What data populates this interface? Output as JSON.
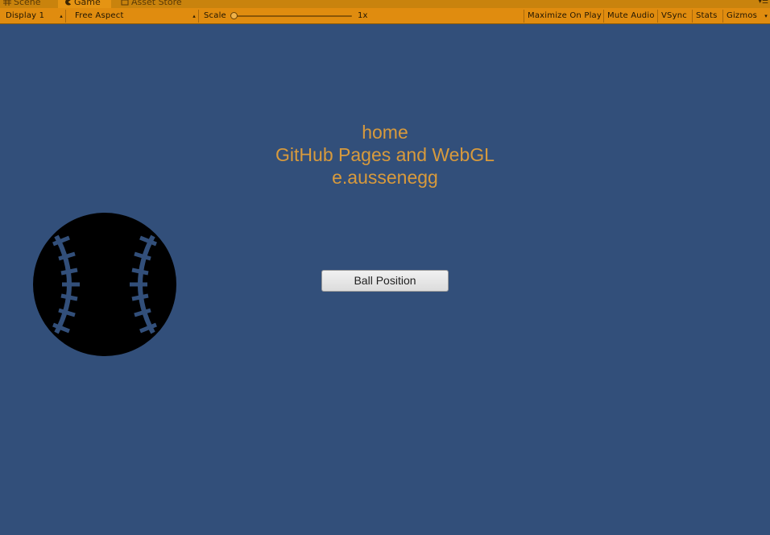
{
  "tabs": [
    {
      "label": "Scene",
      "icon": "grid-icon",
      "active": false
    },
    {
      "label": "Game",
      "icon": "pacman-icon",
      "active": true
    },
    {
      "label": "Asset Store",
      "icon": "store-icon",
      "active": false
    }
  ],
  "toolbar": {
    "display": "Display 1",
    "aspect": "Free Aspect",
    "scale_label": "Scale",
    "scale_value": "1x",
    "maximize_on_play": "Maximize On Play",
    "mute_audio": "Mute Audio",
    "vsync": "VSync",
    "stats": "Stats",
    "gizmos": "Gizmos"
  },
  "game": {
    "title_lines": [
      "home",
      "GitHub Pages and WebGL",
      "e.aussenegg"
    ],
    "button_label": "Ball Position",
    "background_color": "#324f7a",
    "text_color": "#d89a3c",
    "ball_icon": "baseball-icon"
  },
  "colors": {
    "toolbar": "#e08c0f",
    "tabbar": "#c9830d"
  }
}
